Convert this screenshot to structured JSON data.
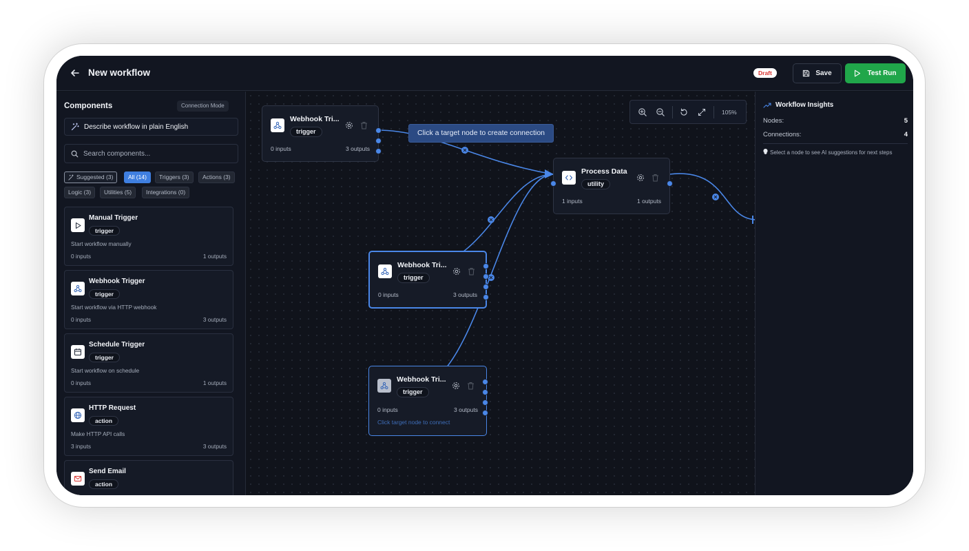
{
  "header": {
    "title": "New workflow",
    "status_badge": "Draft",
    "save_label": "Save",
    "test_run_label": "Test Run"
  },
  "sidebar": {
    "title": "Components",
    "connection_mode_label": "Connection Mode",
    "describe_label": "Describe workflow in plain English",
    "search_placeholder": "Search components...",
    "filters": [
      {
        "label": "Suggested (3)"
      },
      {
        "label": "All (14)",
        "active": true
      },
      {
        "label": "Triggers (3)"
      },
      {
        "label": "Actions (3)"
      },
      {
        "label": "Logic (3)"
      },
      {
        "label": "Utilities (5)"
      },
      {
        "label": "Integrations (0)"
      }
    ],
    "components": [
      {
        "name": "Manual Trigger",
        "tag": "trigger",
        "description": "Start workflow manually",
        "inputs": "0 inputs",
        "outputs": "1 outputs",
        "icon": "play-icon"
      },
      {
        "name": "Webhook Trigger",
        "tag": "trigger",
        "description": "Start workflow via HTTP webhook",
        "inputs": "0 inputs",
        "outputs": "3 outputs",
        "icon": "webhook-icon"
      },
      {
        "name": "Schedule Trigger",
        "tag": "trigger",
        "description": "Start workflow on schedule",
        "inputs": "0 inputs",
        "outputs": "1 outputs",
        "icon": "calendar-icon"
      },
      {
        "name": "HTTP Request",
        "tag": "action",
        "description": "Make HTTP API calls",
        "inputs": "3 inputs",
        "outputs": "3 outputs",
        "icon": "globe-icon"
      },
      {
        "name": "Send Email",
        "tag": "action",
        "description": "",
        "inputs": "",
        "outputs": "",
        "icon": "mail-icon"
      }
    ]
  },
  "canvas": {
    "zoom_level": "105%",
    "tooltip": "Click a target node to create connection",
    "nodes": [
      {
        "name": "Webhook Tri...",
        "tag": "trigger",
        "inputs": "0 inputs",
        "outputs": "3 outputs"
      },
      {
        "name": "Process Data",
        "tag": "utility",
        "inputs": "1 inputs",
        "outputs": "1 outputs"
      },
      {
        "name": "Webhook Tri...",
        "tag": "trigger",
        "inputs": "0 inputs",
        "outputs": "3 outputs"
      },
      {
        "name": "Webhook Tri...",
        "tag": "trigger",
        "inputs": "0 inputs",
        "outputs": "3 outputs",
        "hint": "Click target node to connect"
      }
    ]
  },
  "insights": {
    "title": "Workflow Insights",
    "nodes_label": "Nodes:",
    "nodes_value": "5",
    "connections_label": "Connections:",
    "connections_value": "4",
    "note": "Select a node to see AI suggestions for next steps"
  },
  "colors": {
    "accent": "#4a87e8",
    "run_green": "#20a64a",
    "draft_red": "#d8322f",
    "background": "#10131b"
  }
}
